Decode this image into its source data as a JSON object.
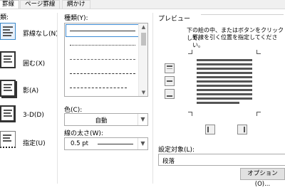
{
  "tabs": [
    "罫線",
    "ページ罫線",
    "網かけ"
  ],
  "settings": {
    "items": [
      {
        "label": "罫線なし(N)"
      },
      {
        "label": "囲む(X)"
      },
      {
        "label": "影(A)"
      },
      {
        "label": "3-D(D)"
      },
      {
        "label": "指定(U)"
      }
    ],
    "selected_index": 0
  },
  "style": {
    "label": "種類(Y):"
  },
  "color": {
    "label": "色(C):",
    "value": "自動"
  },
  "width": {
    "label": "線の太さ(W):",
    "value": "0.5 pt"
  },
  "preview": {
    "title": "プレビュー",
    "instruction_line1": "下の絵の中、またはボタンをクリックして、",
    "instruction_line2": "罫線を引く位置を指定してください。"
  },
  "apply_to": {
    "label": "設定対象(L):",
    "value": "段落"
  },
  "options_button": "オプション(O)..."
}
